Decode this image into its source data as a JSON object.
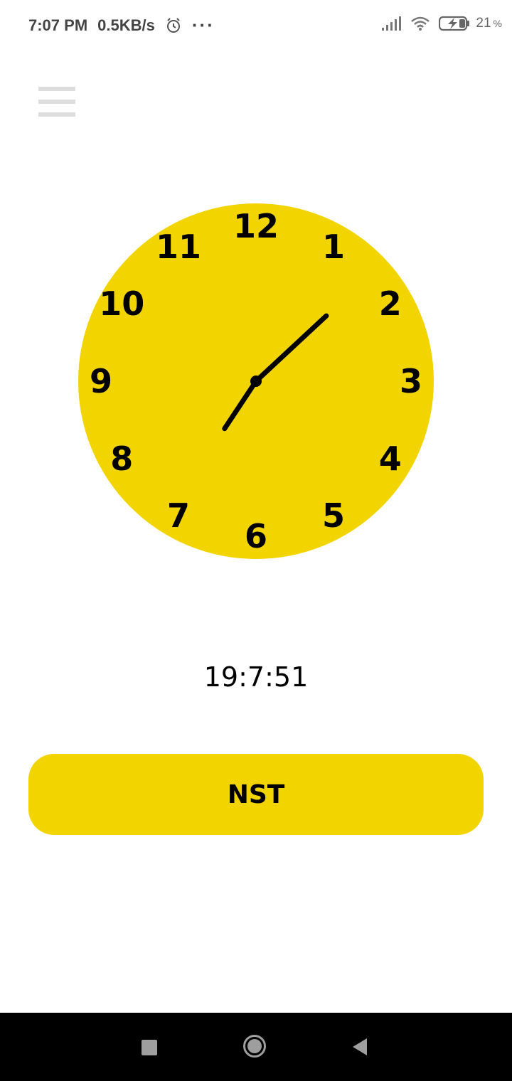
{
  "status_bar": {
    "time": "7:07 PM",
    "network_speed": "0.5KB/s",
    "more": "···",
    "battery": "21",
    "battery_unit": "%",
    "icons": [
      "alarm-icon",
      "signal-icon",
      "wifi-icon",
      "battery-charging-icon"
    ]
  },
  "menu": {
    "icon": "hamburger-menu-icon"
  },
  "clock": {
    "face_color": "#f2d500",
    "numerals": [
      "12",
      "1",
      "2",
      "3",
      "4",
      "5",
      "6",
      "7",
      "8",
      "9",
      "10",
      "11"
    ],
    "hour": 19,
    "minute": 7,
    "second": 51
  },
  "digital_time": "19:7:51",
  "timezone_button": {
    "label": "NST",
    "color": "#f2d500"
  },
  "nav_bar": {
    "icons": [
      "recent-apps-icon",
      "home-icon",
      "back-icon"
    ]
  }
}
